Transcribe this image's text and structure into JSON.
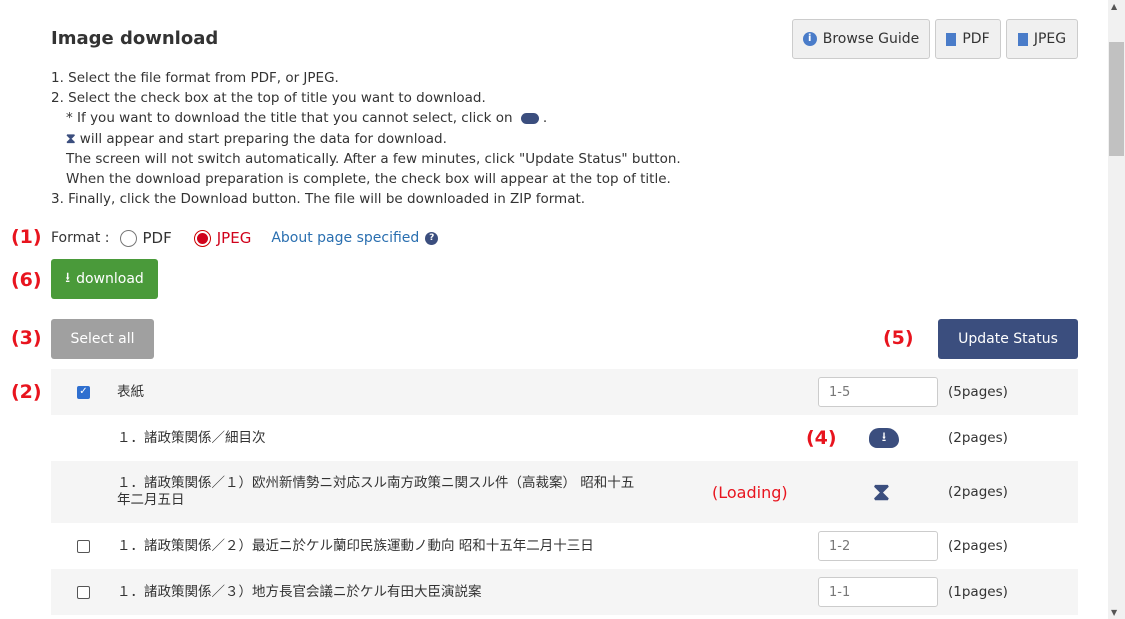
{
  "title": "Image download",
  "header_buttons": {
    "guide": "Browse Guide",
    "pdf": "PDF",
    "jpeg": "JPEG"
  },
  "instructions": [
    "1. Select the file format from PDF, or JPEG.",
    "2. Select the check box at the top of title you want to download.",
    "* If you want to download the title that you cannot select, click on",
    "will appear and start preparing the data for download.",
    "The screen will not switch automatically. After a few minutes, click \"Update Status\" button.",
    "When the download preparation is complete, the check box will appear at the top of title.",
    "3. Finally, click the Download button. The file will be downloaded in ZIP format."
  ],
  "annotations": {
    "a1": "(1)",
    "a2": "(2)",
    "a3": "(3)",
    "a4": "(4)",
    "a5": "(5)",
    "a6": "(6)",
    "loading": "(Loading)"
  },
  "format": {
    "label": "Format :",
    "pdf": "PDF",
    "jpeg": "JPEG",
    "selected": "JPEG",
    "about": "About page specified"
  },
  "download_label": "download",
  "select_all": "Select all",
  "update_status": "Update Status",
  "accent": "#3b4e7e",
  "rows": [
    {
      "title": "表紙",
      "checked": true,
      "pages_value": "1-5",
      "pages": "(5pages)"
    },
    {
      "title": "１．諸政策関係／細目次",
      "status": "cloud-download",
      "pages": "(2pages)"
    },
    {
      "title": "１．諸政策関係／１）欧州新情勢ニ対応スル南方政策ニ関スル件（高裁案） 昭和十五",
      "title2": "年二月五日",
      "status": "hourglass",
      "pages": "(2pages)"
    },
    {
      "title": "１．諸政策関係／２）最近ニ於ケル蘭印民族運動ノ動向 昭和十五年二月十三日",
      "checked": false,
      "pages_value": "1-2",
      "pages": "(2pages)"
    },
    {
      "title": "１．諸政策関係／３）地方長官会議ニ於ケル有田大臣演説案",
      "checked": false,
      "pages_value": "1-1",
      "pages": "(1pages)"
    }
  ]
}
